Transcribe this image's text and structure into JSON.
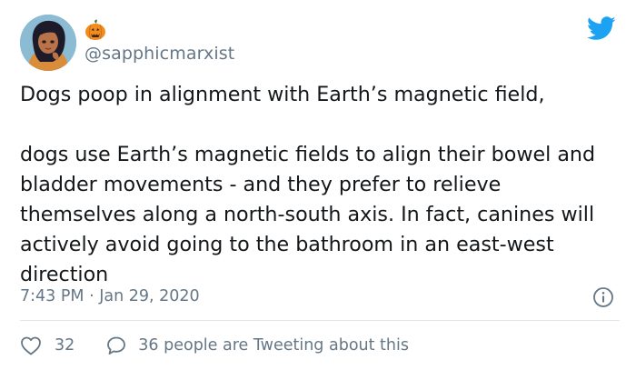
{
  "author": {
    "handle": "@sapphicmarxist",
    "name_emoji": "pumpkin-icon"
  },
  "tweet": {
    "lines": [
      "Dogs poop in alignment with Earth’s magnetic field,",
      "dogs use Earth’s magnetic fields to align their bowel and bladder movements - and they prefer to relieve themselves along a north-south axis. In fact, canines will actively avoid going to the bathroom in an east-west direction"
    ],
    "timestamp": "7:43 PM · Jan 29, 2020"
  },
  "actions": {
    "like_count": "32",
    "replies_text": "36 people are Tweeting about this"
  },
  "colors": {
    "twitter_blue": "#1da1f2",
    "secondary_text": "#657786",
    "primary_text": "#14171a",
    "divider": "#e1e8ed"
  }
}
